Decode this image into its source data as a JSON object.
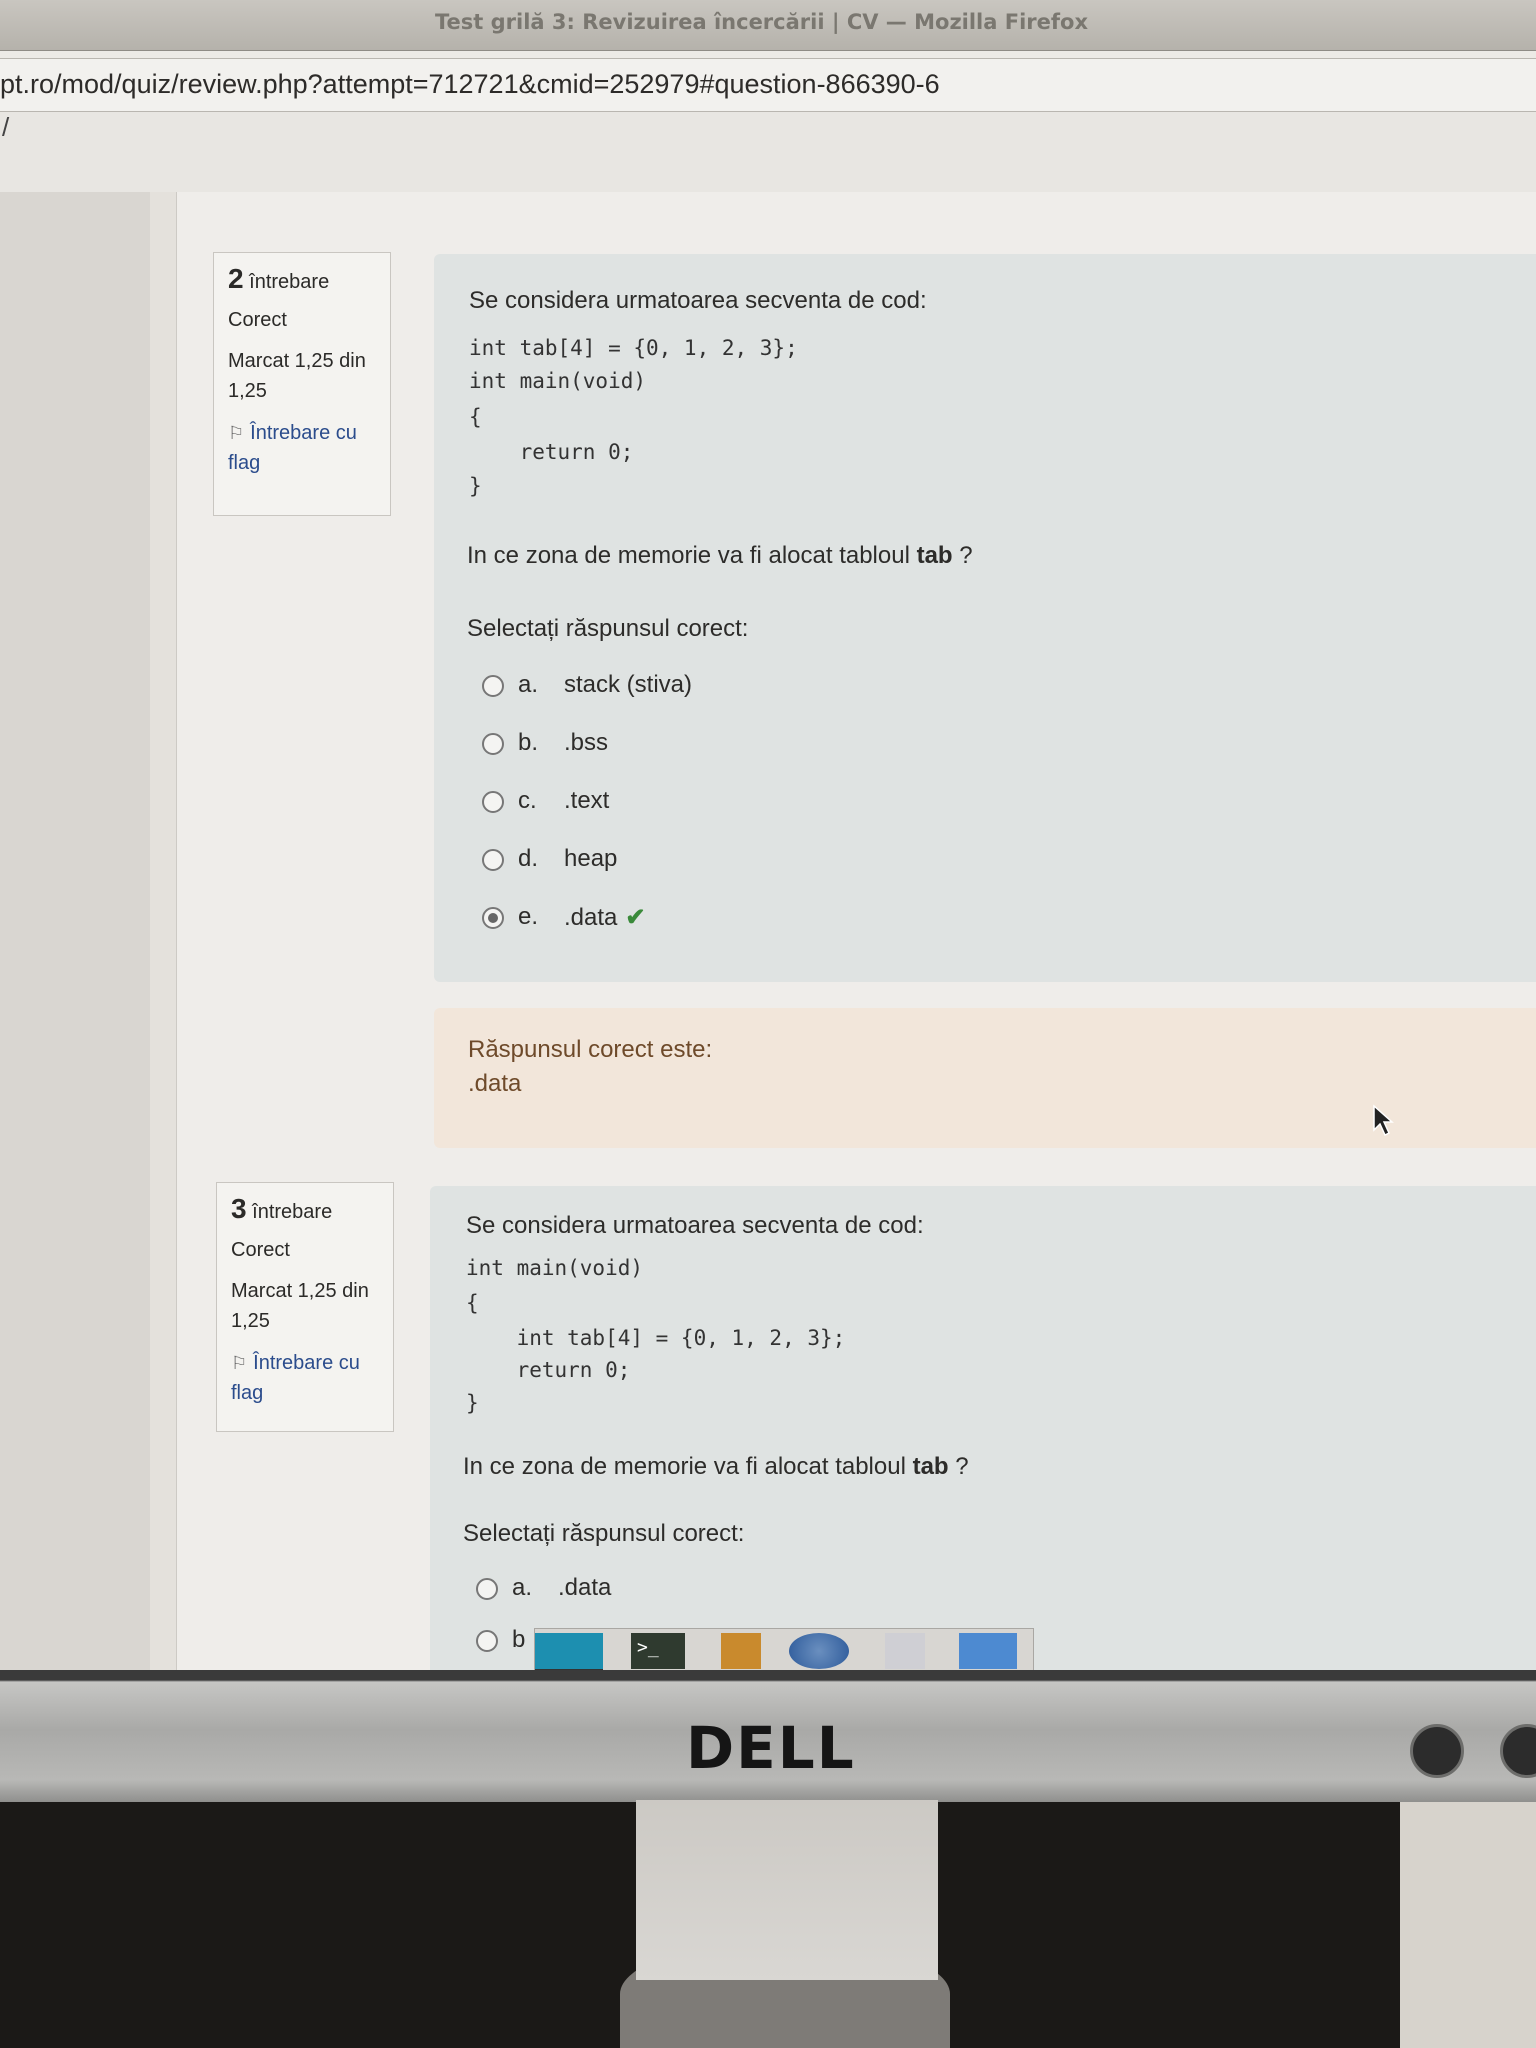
{
  "window": {
    "title": "Test grilă 3: Revizuirea încercării | CV — Mozilla Firefox"
  },
  "browser": {
    "url": "pt.ro/mod/quiz/review.php?attempt=712721&cmid=252979#question-866390-6"
  },
  "questions": [
    {
      "number": "2",
      "number_label": "întrebare",
      "state": "Corect",
      "grade": "Marcat 1,25 din 1,25",
      "flag_label": "Întrebare cu flag",
      "intro": "Se considera urmatoarea secventa de cod:",
      "code": [
        "int tab[4] = {0, 1, 2, 3};",
        "int main(void)",
        "{",
        "    return 0;",
        "}"
      ],
      "ask_prefix": "In ce zona de memorie va fi alocat tabloul ",
      "ask_bold": "tab",
      "ask_suffix": " ?",
      "prompt": "Selectați răspunsul corect:",
      "options": [
        {
          "letter": "a.",
          "label": "stack (stiva)",
          "selected": false
        },
        {
          "letter": "b.",
          "label": ".bss",
          "selected": false
        },
        {
          "letter": "c.",
          "label": ".text",
          "selected": false
        },
        {
          "letter": "d.",
          "label": "heap",
          "selected": false
        },
        {
          "letter": "e.",
          "label": ".data",
          "selected": true,
          "mark": "correct"
        }
      ],
      "feedback_title": "Răspunsul corect este:",
      "feedback_answer": ".data"
    },
    {
      "number": "3",
      "number_label": "întrebare",
      "state": "Corect",
      "grade": "Marcat 1,25 din 1,25",
      "flag_label": "Întrebare cu flag",
      "intro": "Se considera urmatoarea secventa de cod:",
      "code": [
        "int main(void)",
        "{",
        "    int tab[4] = {0, 1, 2, 3};",
        "    return 0;",
        "}"
      ],
      "ask_prefix": "In ce zona de memorie va fi alocat tabloul ",
      "ask_bold": "tab",
      "ask_suffix": " ?",
      "prompt": "Selectați răspunsul corect:",
      "options": [
        {
          "letter": "a.",
          "label": ".data",
          "selected": false
        },
        {
          "letter": "b",
          "label": "",
          "selected": false
        }
      ]
    }
  ],
  "monitor": {
    "brand": "DELL"
  },
  "colors": {
    "accent_link": "#2b4c8c",
    "correct": "#3a8a3a",
    "feedback_bg": "#f2e6da",
    "question_bg": "#dfe3e2"
  }
}
